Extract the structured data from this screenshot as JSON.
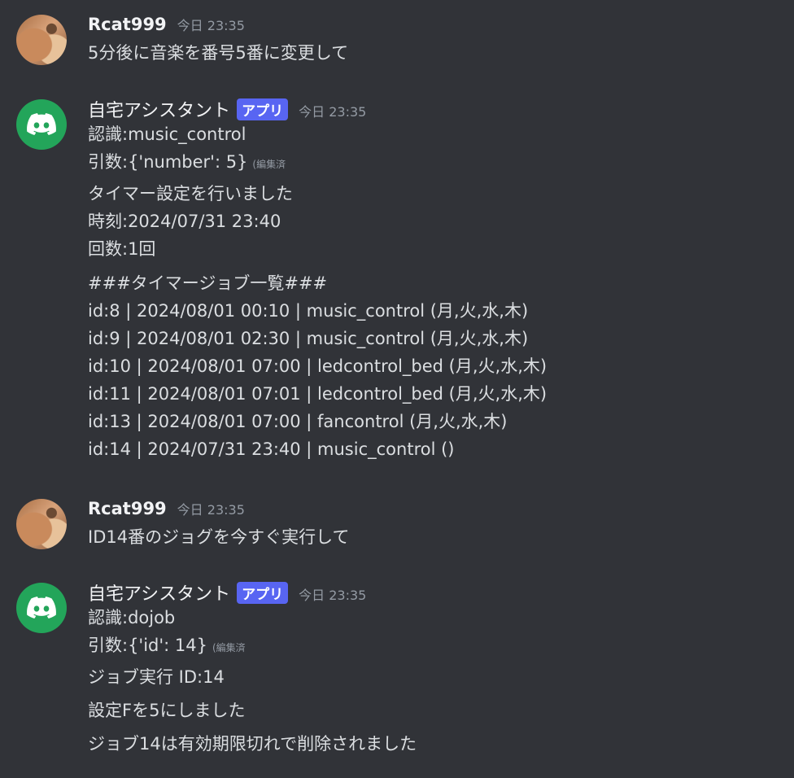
{
  "messages": [
    {
      "author": "Rcat999",
      "time": "今日 23:35",
      "text": "5分後に音楽を番号5番に変更して"
    },
    {
      "author": "自宅アシスタント",
      "app_tag": "アプリ",
      "time": "今日 23:35",
      "recognition": "認識:music_control",
      "args": "引数:{'number': 5}",
      "edited": "(編集済",
      "block1": [
        "タイマー設定を行いました",
        "時刻:2024/07/31 23:40",
        "回数:1回"
      ],
      "block2": [
        "###タイマージョブ一覧###",
        "id:8 | 2024/08/01 00:10 | music_control (月,火,水,木)",
        "id:9 | 2024/08/01 02:30 | music_control (月,火,水,木)",
        "id:10 | 2024/08/01 07:00 | ledcontrol_bed (月,火,水,木)",
        "id:11 | 2024/08/01 07:01 | ledcontrol_bed (月,火,水,木)",
        "id:13 | 2024/08/01 07:00 | fancontrol (月,火,水,木)",
        "id:14 | 2024/07/31 23:40 | music_control ()"
      ]
    },
    {
      "author": "Rcat999",
      "time": "今日 23:35",
      "text": "ID14番のジョグを今すぐ実行して"
    },
    {
      "author": "自宅アシスタント",
      "app_tag": "アプリ",
      "time": "今日 23:35",
      "recognition": "認識:dojob",
      "args": "引数:{'id': 14}",
      "edited": "(編集済",
      "block1": [
        "ジョブ実行 ID:14"
      ],
      "block2": [
        "設定Fを5にしました"
      ],
      "block3": [
        "ジョブ14は有効期限切れで削除されました"
      ]
    }
  ],
  "colors": {
    "background": "#313338",
    "text": "#dbdee1",
    "muted": "#949ba4",
    "app_tag": "#5865f2",
    "bot_avatar": "#23a55a"
  },
  "icons": {
    "user_avatar": "cat-photo-avatar",
    "bot_avatar": "discord-logo-icon"
  }
}
